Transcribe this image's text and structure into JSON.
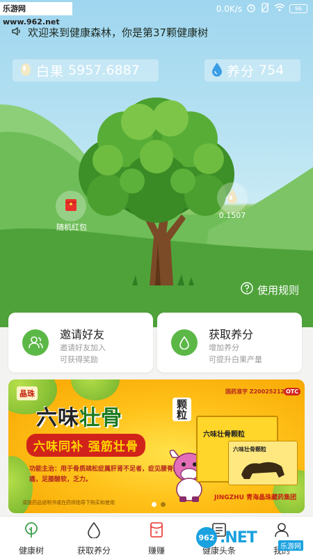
{
  "status_bar": {
    "watermark": "乐游网 www.962.net",
    "speed": "0.0K/s",
    "battery": "96"
  },
  "welcome": {
    "text": "欢迎来到健康森林，你是第37颗健康树"
  },
  "stats": {
    "fruit_label": "白果",
    "fruit_value": "5957.6887",
    "nutrient_label": "养分",
    "nutrient_value": "754"
  },
  "bubbles": {
    "red_packet_label": "随机红包",
    "drop_value": "0.1507"
  },
  "rules": {
    "label": "使用规则"
  },
  "cards": [
    {
      "title": "邀请好友",
      "sub1": "邀请好友加入",
      "sub2": "可获得奖励",
      "icon": "users-icon"
    },
    {
      "title": "获取养分",
      "sub1": "增加养分",
      "sub2": "可提升白果产量",
      "icon": "water-drop-icon"
    }
  ],
  "ad": {
    "brand": "晶珠",
    "title_a": "六味",
    "title_b": "壮骨",
    "granule": "颗粒",
    "slogan": "六味同补  强筋壮骨",
    "function": "功能主治：用于骨质疏松症属肝肾不足者，症见腰脊酸痛，足膝酸软，乏力。",
    "approval": "国药准字 Z20025212",
    "otc": "OTC",
    "box_label": "六味壮骨颗粒",
    "box2_label": "六味壮骨颗粒",
    "company": "JINGZHU 青海晶珠藏药集团",
    "small_print": "请按药品说明书或在药师指导下购买和使用",
    "pages": 2,
    "active_page": 0
  },
  "nav": [
    {
      "label": "健康树",
      "icon": "tree-icon",
      "active": true
    },
    {
      "label": "获取养分",
      "icon": "water-drop-icon",
      "active": false
    },
    {
      "label": "赚赚",
      "icon": "red-packet-icon",
      "active": false
    },
    {
      "label": "健康头条",
      "icon": "news-icon",
      "active": false
    },
    {
      "label": "我的",
      "icon": "profile-icon",
      "active": false
    }
  ],
  "watermark": {
    "logo": "962",
    "domain": ".NET",
    "sub": "乐游网"
  },
  "colors": {
    "accent_green": "#5bb847",
    "sky": "#b7e2f2",
    "grass": "#4fa23a"
  }
}
